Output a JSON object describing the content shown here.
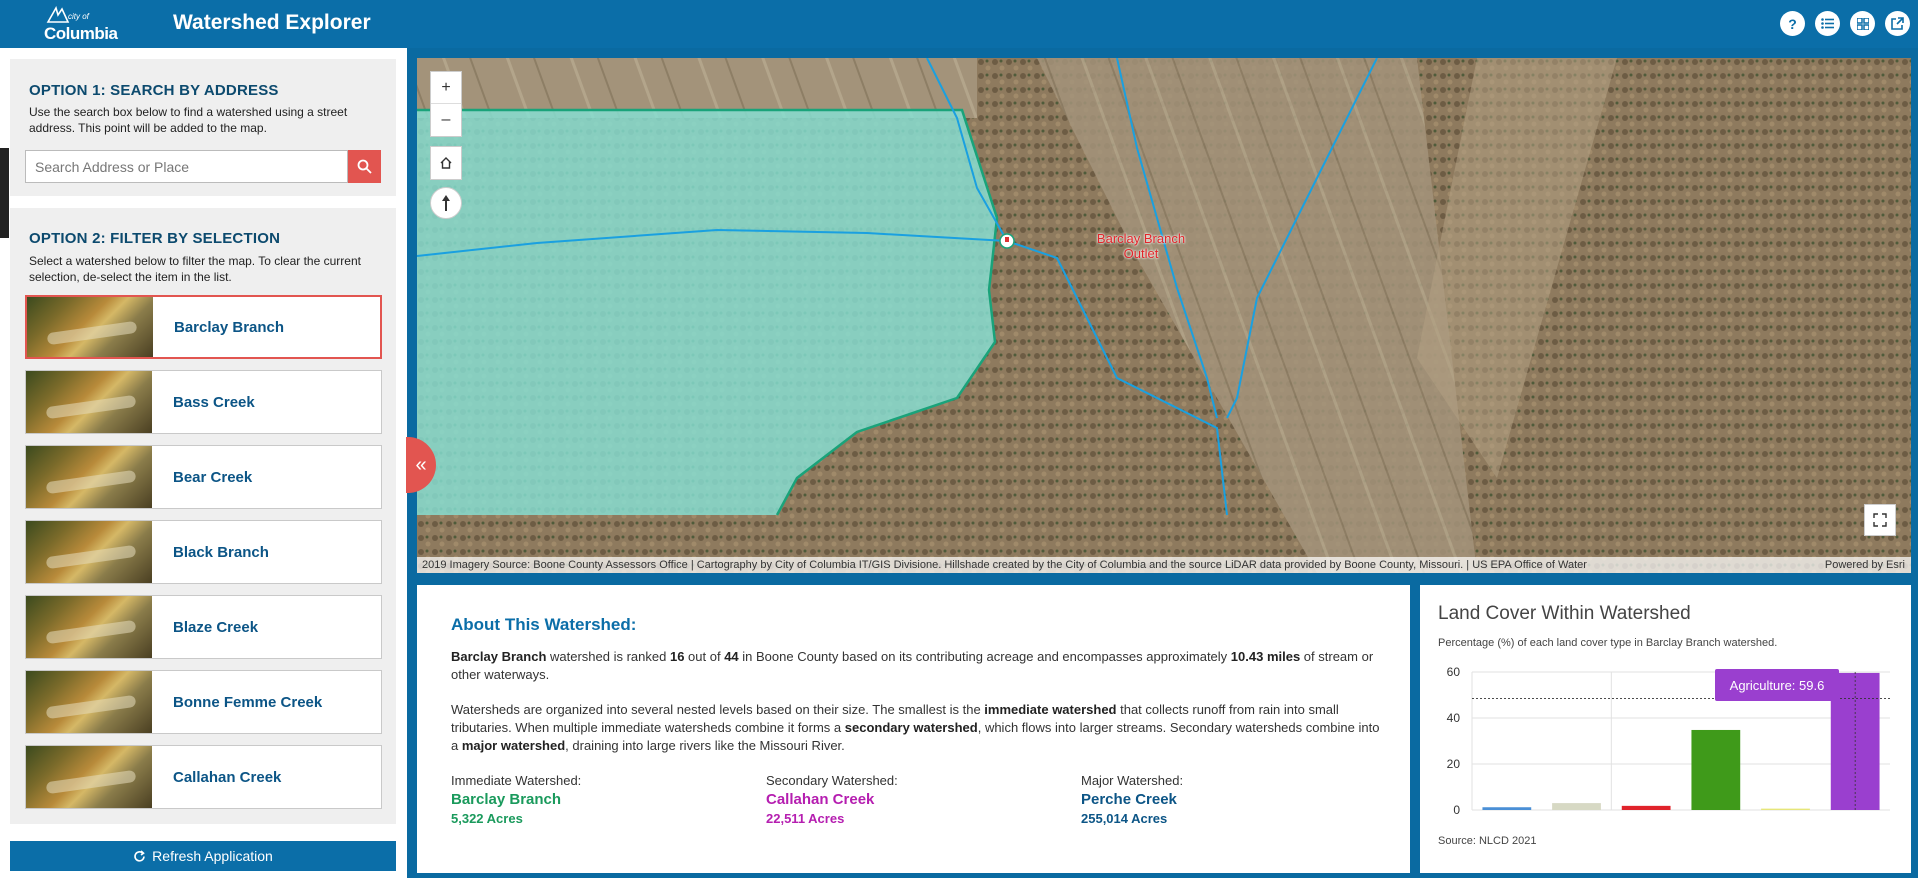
{
  "header": {
    "logo_small": "city of",
    "logo_big": "Columbia",
    "title": "Watershed Explorer",
    "icons": [
      "help-icon",
      "list-icon",
      "grid-icon",
      "share-icon"
    ]
  },
  "option1": {
    "title": "OPTION 1: SEARCH BY ADDRESS",
    "description": "Use the search box below to find a watershed using a street address. This point will be added to the map.",
    "search_placeholder": "Search Address or Place"
  },
  "option2": {
    "title": "OPTION 2: FILTER BY SELECTION",
    "description": "Select a watershed below to filter the map.  To clear the current selection, de-select the item in the list.",
    "items": [
      {
        "name": "Barclay Branch",
        "selected": true
      },
      {
        "name": "Bass Creek",
        "selected": false
      },
      {
        "name": "Bear Creek",
        "selected": false
      },
      {
        "name": "Black Branch",
        "selected": false
      },
      {
        "name": "Blaze Creek",
        "selected": false
      },
      {
        "name": "Bonne Femme Creek",
        "selected": false
      },
      {
        "name": "Callahan Creek",
        "selected": false
      }
    ]
  },
  "refresh_label": "Refresh Application",
  "map": {
    "zoom_in": "+",
    "zoom_out": "–",
    "outlet_label": "Barclay Branch Outlet",
    "attribution": "2019 Imagery Source: Boone County Assessors Office | Cartography by City of Columbia IT/GIS Divisione. Hillshade created by the City of Columbia and the source LiDAR data provided by Boone County, Missouri. | US EPA Office of Water",
    "powered_by": "Powered by Esri"
  },
  "about": {
    "title": "About This Watershed:",
    "p1_name": "Barclay Branch",
    "p1_a": " watershed is ranked ",
    "p1_rank": "16",
    "p1_b": " out of ",
    "p1_total": "44",
    "p1_c": " in Boone County based on its contributing acreage and encompasses approximately ",
    "p1_miles": "10.43 miles",
    "p1_d": " of stream or other waterways.",
    "p2_a": "Watersheds are organized into several nested levels based on their size. The smallest is the ",
    "p2_b": "immediate watershed",
    "p2_c": " that collects runoff from rain into small tributaries. When multiple immediate watersheds combine it forms a ",
    "p2_d": "secondary watershed",
    "p2_e": ", which flows into larger streams. Secondary watersheds combine into a ",
    "p2_f": "major watershed",
    "p2_g": ", draining into large rivers like the Missouri River.",
    "levels": [
      {
        "label": "Immediate Watershed:",
        "name": "Barclay Branch",
        "acres": "5,322 Acres",
        "color": "#1a9a5c"
      },
      {
        "label": "Secondary Watershed:",
        "name": "Callahan Creek",
        "acres": "22,511 Acres",
        "color": "#b51eb0"
      },
      {
        "label": "Major Watershed:",
        "name": "Perche Creek",
        "acres": "255,014 Acres",
        "color": "#0c5586"
      }
    ]
  },
  "chart_panel": {
    "title": "Land Cover Within Watershed",
    "subtitle": "Percentage (%) of each land cover type in Barclay Branch watershed.",
    "source": "Source: NLCD 2021",
    "tooltip": "Agriculture: 59.6"
  },
  "chart_data": {
    "type": "bar",
    "ylim": [
      0,
      60
    ],
    "yticks": [
      0,
      20,
      40,
      60
    ],
    "series": [
      {
        "values": [
          1.2,
          3.0,
          1.8,
          34.8,
          0.6,
          59.6
        ]
      }
    ],
    "colors": [
      "#4a8fd6",
      "#d7d9c4",
      "#e0232b",
      "#3f9a1a",
      "#e6e67a",
      "#9a3fcf"
    ],
    "reference_line": 48.5,
    "grid": true
  }
}
